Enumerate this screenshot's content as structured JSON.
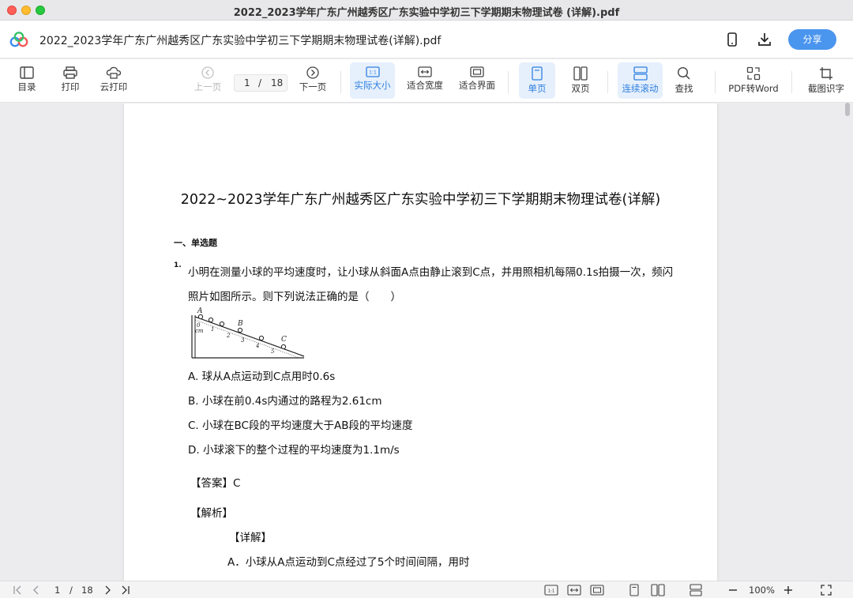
{
  "window": {
    "title": "2022_2023学年广东广州越秀区广东实验中学初三下学期期末物理试卷 (详解).pdf"
  },
  "header": {
    "doc_name": "2022_2023学年广东广州越秀区广东实验中学初三下学期期末物理试卷(详解).pdf",
    "share_label": "分享",
    "icons": [
      "app-logo",
      "mobile-icon",
      "download-icon"
    ]
  },
  "toolbar": {
    "toc": "目录",
    "print": "打印",
    "cloud_print": "云打印",
    "prev": "上一页",
    "page_current": "1",
    "page_sep": "/",
    "page_total": "18",
    "next": "下一页",
    "actual_size": "实际大小",
    "fit_width": "适合宽度",
    "fit_page": "适合界面",
    "single": "单页",
    "double": "双页",
    "continuous": "连续滚动",
    "find": "查找",
    "pdf_to_word": "PDF转Word",
    "ocr": "截图识字",
    "accent": "#2f7fe0"
  },
  "document": {
    "title": "2022~2023学年广东广州越秀区广东实验中学初三下学期期末物理试卷(详解)",
    "section": "一、单选题",
    "q_number": "1.",
    "q_line1": "小明在测量小球的平均速度时，让小球从斜面A点由静止滚到C点，并用照相机每隔0.1s拍摄一次，频闪",
    "q_line2": "照片如图所示。则下列说法正确的是（　　）",
    "figure_labels": {
      "a": "A",
      "b": "B",
      "c": "C",
      "zero": "0",
      "cm": "cm",
      "t1": "1",
      "t2": "2",
      "t3": "3",
      "t4": "4",
      "t5": "5"
    },
    "options": [
      "A. 球从A点运动到C点用时0.6s",
      "B. 小球在前0.4s内通过的路程为2.61cm",
      "C. 小球在BC段的平均速度大于AB段的平均速度",
      "D. 小球滚下的整个过程的平均速度为1.1m/s"
    ],
    "answer": "【答案】C",
    "analysis": "【解析】",
    "detail": "【详解】",
    "detail_a": "A．小球从A点运动到C点经过了5个时间间隔，用时"
  },
  "statusbar": {
    "page_current": "1",
    "page_sep": "/",
    "page_total": "18",
    "zoom": "100%"
  }
}
